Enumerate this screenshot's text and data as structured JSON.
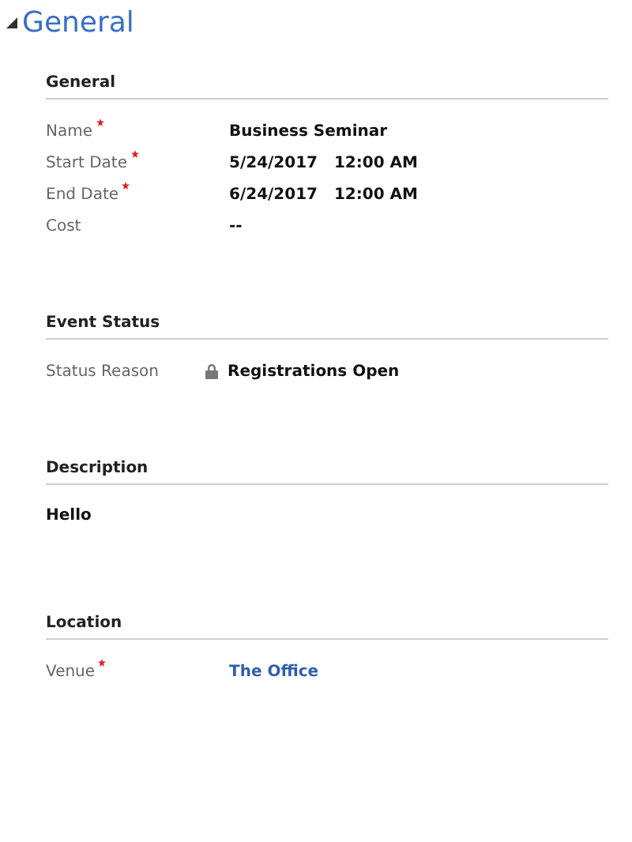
{
  "tab": {
    "title": "General",
    "expanded": true
  },
  "sections": [
    {
      "title": "General",
      "kind": "fields",
      "fields": [
        {
          "label": "Name",
          "required": true,
          "kind": "text",
          "value": "Business Seminar"
        },
        {
          "label": "Start Date",
          "required": true,
          "kind": "date",
          "value": "5/24/2017",
          "time": "12:00 AM"
        },
        {
          "label": "End Date",
          "required": true,
          "kind": "date",
          "value": "6/24/2017",
          "time": "12:00 AM"
        },
        {
          "label": "Cost",
          "required": false,
          "kind": "text",
          "value": "--"
        }
      ]
    },
    {
      "title": "Event Status",
      "kind": "fields",
      "fields": [
        {
          "label": "Status Reason",
          "required": false,
          "kind": "locked",
          "value": "Registrations Open"
        }
      ]
    },
    {
      "title": "Description",
      "kind": "text",
      "text": "Hello"
    },
    {
      "title": "Location",
      "kind": "fields",
      "fields": [
        {
          "label": "Venue",
          "required": true,
          "kind": "link",
          "value": "The Office"
        }
      ]
    }
  ]
}
